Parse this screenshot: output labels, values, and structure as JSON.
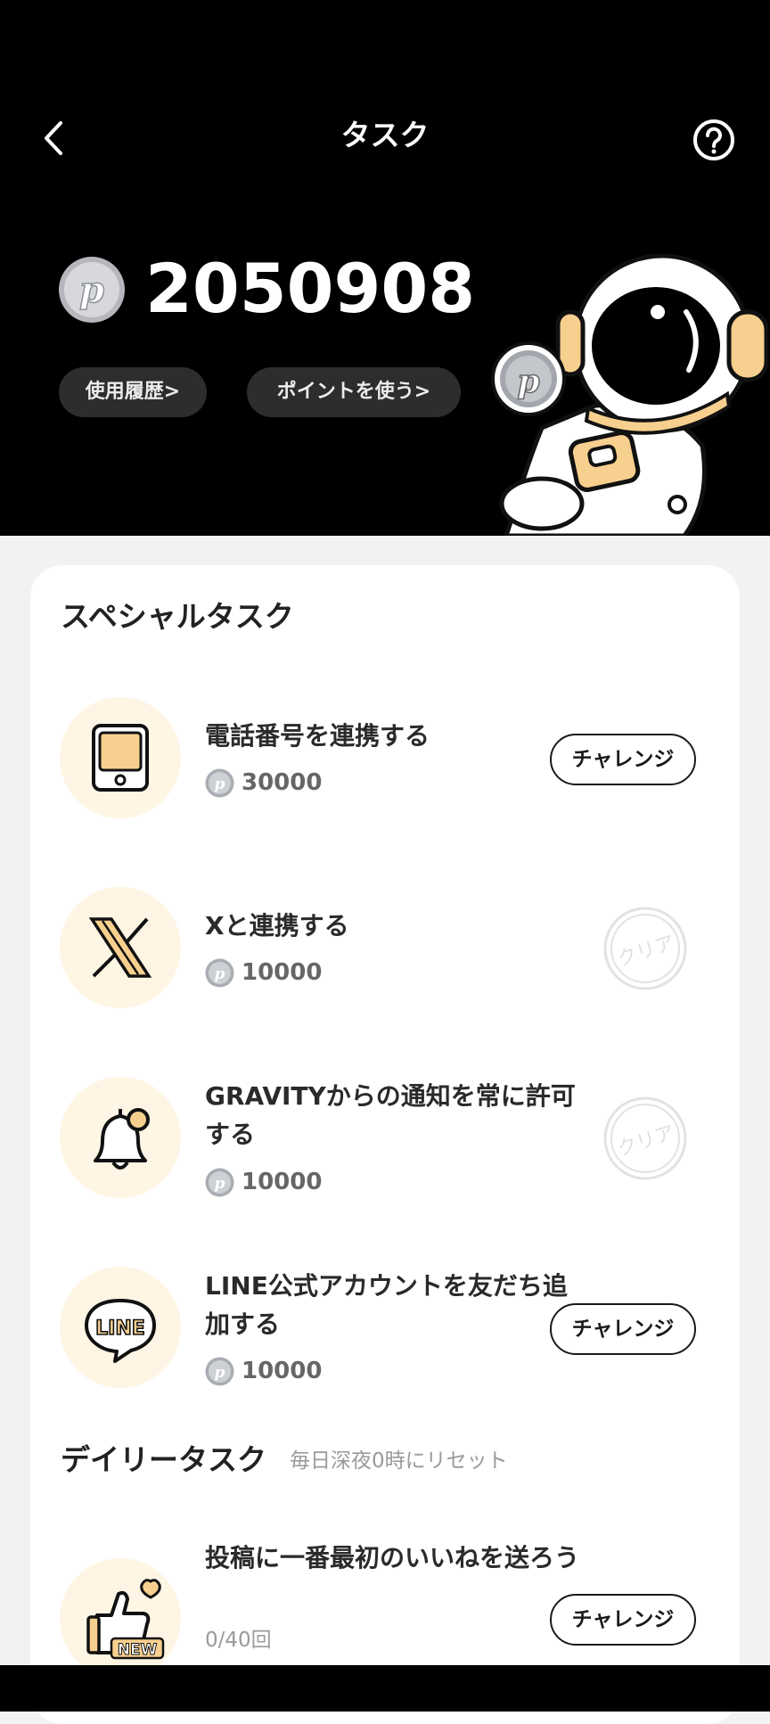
{
  "header": {
    "title": "タスク",
    "balance": "2050908",
    "history_label": "使用履歴>",
    "use_points_label": "ポイントを使う>"
  },
  "special": {
    "title": "スペシャルタスク",
    "tasks": [
      {
        "title": "電話番号を連携する",
        "reward": "30000",
        "status": "チャレンジ",
        "icon": "phone-icon"
      },
      {
        "title": "Xと連携する",
        "reward": "10000",
        "status": "クリア",
        "icon": "x-logo-icon"
      },
      {
        "title": "GRAVITYからの通知を常に許可する",
        "reward": "10000",
        "status": "クリア",
        "icon": "bell-icon"
      },
      {
        "title": "LINE公式アカウントを友だち追加する",
        "reward": "10000",
        "status": "チャレンジ",
        "icon": "line-icon"
      }
    ]
  },
  "daily": {
    "title": "デイリータスク",
    "subtitle": "毎日深夜0時にリセット",
    "tasks": [
      {
        "title": "投稿に一番最初のいいねを送ろう",
        "progress": "0/40回",
        "status": "チャレンジ",
        "icon": "thumbs-up-new-icon"
      }
    ]
  },
  "colors": {
    "icon_bg": "#fff5e4",
    "accent": "#f7cf8e",
    "header_bg": "#000000"
  }
}
